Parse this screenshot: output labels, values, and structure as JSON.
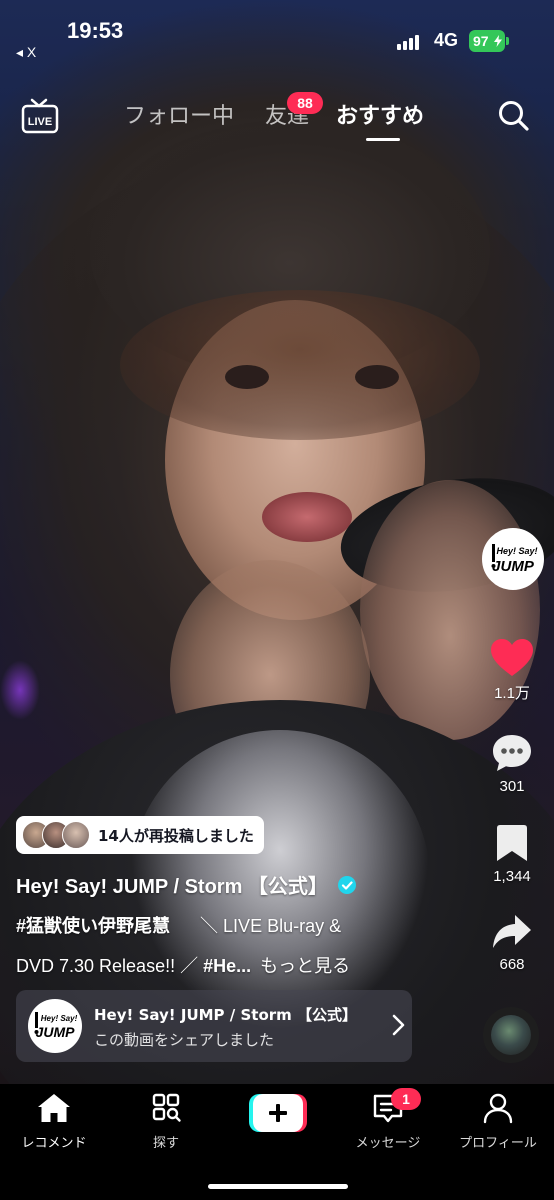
{
  "status_bar": {
    "time": "19:53",
    "back_label": "◂ X",
    "network": "4G",
    "battery": "97"
  },
  "top_nav": {
    "tabs": [
      {
        "label": "フォロー中"
      },
      {
        "label": "友達"
      },
      {
        "label": "おすすめ"
      }
    ],
    "friends_badge": "88",
    "active_tab": "おすすめ"
  },
  "right_rail": {
    "creator_logo": "Hey! Say! JUMP",
    "likes": "1.1万",
    "comments": "301",
    "bookmarks": "1,344",
    "shares": "668"
  },
  "caption": {
    "repost_text": "14人が再投稿しました",
    "author": "Hey! Say! JUMP / Storm 【公式】",
    "line1_tag": "#猛獣使い伊野尾慧",
    "line1_rest": "＼ LIVE Blu-ray &",
    "line2_text": "DVD 7.30 Release!! ／",
    "line2_tag": "#He...",
    "more": "もっと見る"
  },
  "share_card": {
    "title": "Hey! Say! JUMP / Storm 【公式】",
    "subtitle": "この動画をシェアしました"
  },
  "bottom_nav": {
    "items": [
      {
        "label": "レコメンド",
        "icon": "home-icon"
      },
      {
        "label": "探す",
        "icon": "explore-icon"
      },
      {
        "label": "",
        "icon": "create-plus-icon"
      },
      {
        "label": "メッセージ",
        "icon": "inbox-icon"
      },
      {
        "label": "プロフィール",
        "icon": "profile-icon"
      }
    ],
    "inbox_badge": "1"
  },
  "colors": {
    "accent": "#fe2c55",
    "like": "#fe2c55",
    "verified": "#20d5ec",
    "battery": "#34c759"
  }
}
